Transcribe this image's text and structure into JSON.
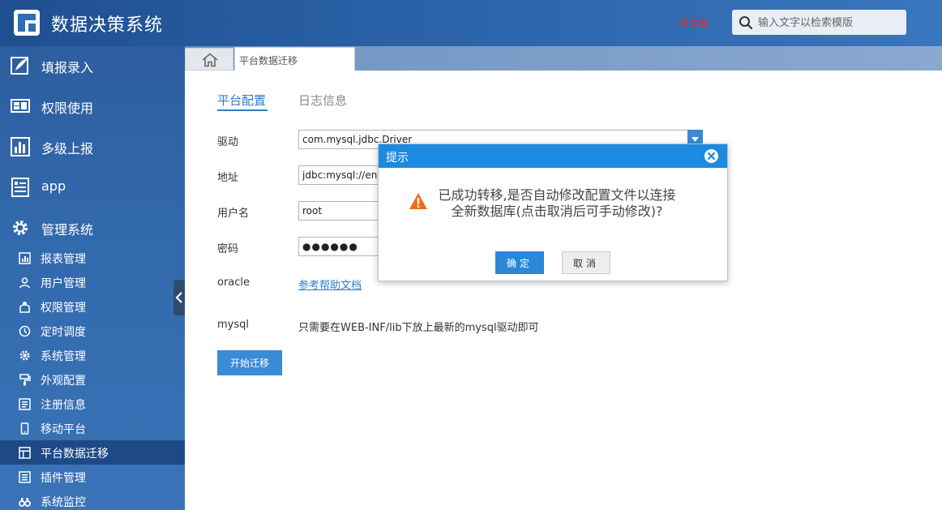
{
  "header": {
    "app_title": "数据决策系统",
    "register_text": "未注册",
    "search_placeholder": "输入文字以检索模版"
  },
  "sidebar": {
    "main_items": [
      {
        "label": "填报录入",
        "icon": "feather-pen-icon"
      },
      {
        "label": "权限使用",
        "icon": "monitor-icon"
      },
      {
        "label": "多级上报",
        "icon": "bar-chart-icon"
      },
      {
        "label": "app",
        "icon": "document-list-icon"
      },
      {
        "label": "管理系统",
        "icon": "gear-icon"
      }
    ],
    "sub_items": [
      {
        "label": "报表管理",
        "icon": "report-icon"
      },
      {
        "label": "用户管理",
        "icon": "user-icon"
      },
      {
        "label": "权限管理",
        "icon": "key-icon"
      },
      {
        "label": "定时调度",
        "icon": "clock-icon"
      },
      {
        "label": "系统管理",
        "icon": "gear-icon"
      },
      {
        "label": "外观配置",
        "icon": "paint-roller-icon"
      },
      {
        "label": "注册信息",
        "icon": "register-icon"
      },
      {
        "label": "移动平台",
        "icon": "mobile-icon"
      },
      {
        "label": "平台数据迁移",
        "icon": "data-table-icon",
        "active": true
      },
      {
        "label": "插件管理",
        "icon": "plugin-icon"
      },
      {
        "label": "系统监控",
        "icon": "binoculars-icon"
      }
    ]
  },
  "tabs": {
    "current": "平台数据迁移"
  },
  "main": {
    "tab_config": "平台配置",
    "tab_log": "日志信息",
    "labels": {
      "driver": "驱动",
      "url": "地址",
      "username": "用户名",
      "password": "密码",
      "oracle": "oracle",
      "mysql": "mysql"
    },
    "values": {
      "driver": "com.mysql.jdbc.Driver",
      "url": "jdbc:mysql://env.",
      "username": "root",
      "password": "●●●●●●"
    },
    "help_link": "参考帮助文档",
    "mysql_note": "只需要在WEB-INF/lib下放上最新的mysql驱动即可",
    "start_button": "开始迁移"
  },
  "dialog": {
    "title": "提示",
    "message_line1": "已成功转移,是否自动修改配置文件以连接",
    "message_line2": "全新数据库(点击取消后可手动修改)?",
    "ok": "确定",
    "cancel": "取消"
  },
  "colors": {
    "primary": "#2b88d8",
    "warning": "#f26b1d",
    "register": "#e8262a"
  }
}
